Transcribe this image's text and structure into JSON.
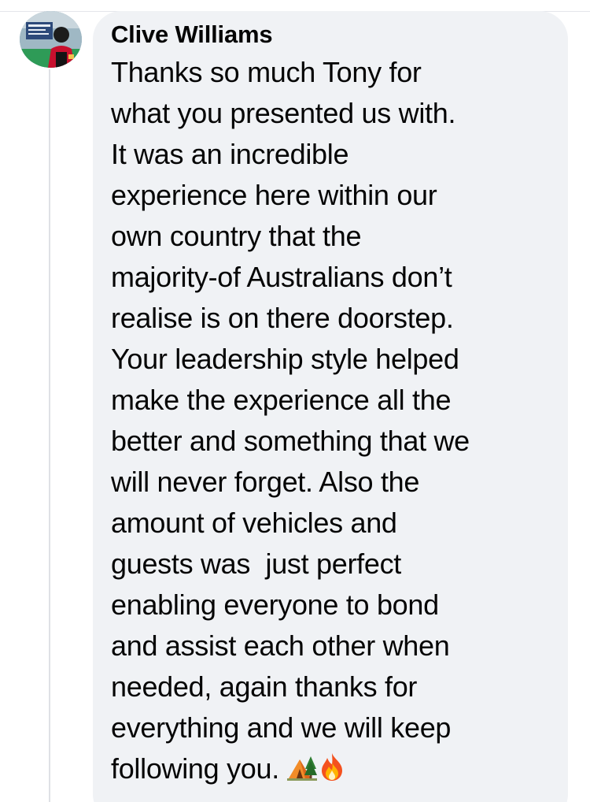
{
  "comment": {
    "author": "Clive Williams",
    "avatar_icon": "profile-photo-avatar",
    "lines": [
      "Thanks so much Tony for",
      "what you presented us with.",
      "It was an incredible",
      "experience here within our",
      "own country that the",
      "majority-of Australians don’t",
      "realise is on there doorstep.",
      "Your leadership style helped",
      "make the experience all the",
      "better and something that we",
      "will never forget. Also the",
      "amount of vehicles and",
      "guests was  just perfect",
      "enabling everyone to bond",
      "and assist each other when",
      "needed, again thanks for",
      "everything and we will keep",
      "following you. "
    ],
    "emojis": [
      "camping-tent-emoji",
      "fire-emoji"
    ]
  },
  "colors": {
    "bubble_background": "#f0f2f5",
    "text": "#050505",
    "thread_line": "#dfe1e5"
  }
}
